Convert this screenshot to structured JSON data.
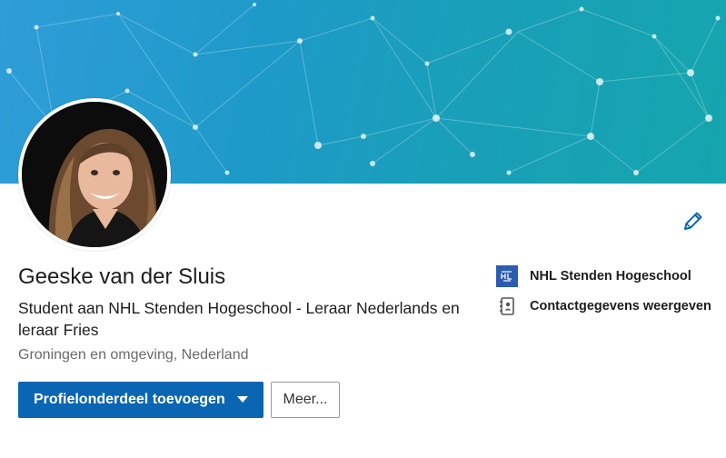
{
  "profile": {
    "name": "Geeske van der Sluis",
    "headline": "Student aan NHL Stenden Hogeschool - Leraar Nederlands en leraar Fries",
    "location": "Groningen en omgeving, Nederland"
  },
  "actions": {
    "primary_label": "Profielonderdeel toevoegen",
    "more_label": "Meer..."
  },
  "sidebar": {
    "school": "NHL Stenden Hogeschool",
    "contact": "Contactgegevens weergeven"
  },
  "colors": {
    "primary_button": "#0a66b2",
    "banner_start": "#2f9dd8",
    "banner_end": "#15a5ae",
    "school_logo": "#2c5bb0"
  },
  "icons": {
    "edit": "pencil-icon",
    "school": "school-logo-icon",
    "contact": "contact-card-icon",
    "dropdown": "caret-down-icon"
  }
}
